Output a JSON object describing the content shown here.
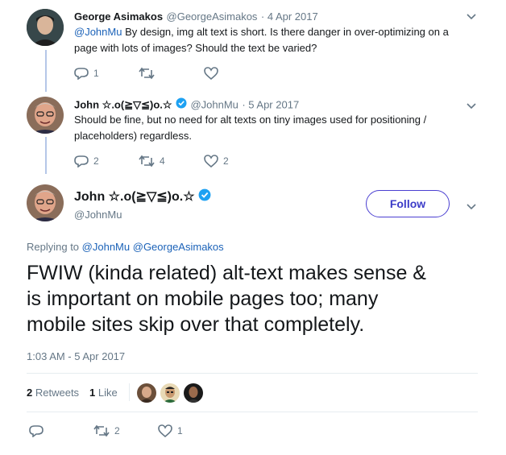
{
  "tweet1": {
    "author_name": "George Asimakos",
    "handle": "@GeorgeAsimakos",
    "date": "· 4 Apr 2017",
    "mention": "@JohnMu",
    "text_after_mention": " By design, img alt text is short. Is there danger in over-optimizing on a",
    "text_line2": "page with lots of images? Should the text be varied?",
    "reply_count": "1",
    "retweet_count": "",
    "like_count": ""
  },
  "tweet2": {
    "author_name": "John ☆.o(≧▽≦)o.☆",
    "handle": "@JohnMu",
    "date": "· 5 Apr 2017",
    "text_line1": "Should be fine, but no need for alt texts on tiny images used for positioning /",
    "text_line2": "placeholders) regardless.",
    "reply_count": "2",
    "retweet_count": "4",
    "like_count": "2"
  },
  "main": {
    "author_name": "John ☆.o(≧▽≦)o.☆",
    "handle": "@JohnMu",
    "follow_label": "Follow",
    "replying_prefix": "Replying to",
    "replying_to_1": "@JohnMu",
    "replying_to_2": "@GeorgeAsimakos",
    "text_line1": "FWIW (kinda related) alt-text makes sense &",
    "text_line2": "is important on mobile pages too; many",
    "text_line3": "mobile sites skip over that completely.",
    "timestamp": "1:03 AM - 5 Apr 2017",
    "retweets_num": "2",
    "retweets_label": "Retweets",
    "likes_num": "1",
    "likes_label": "Like",
    "reply_count": "",
    "retweet_count": "2",
    "like_count": "1"
  },
  "colors": {
    "link": "#1b62b8",
    "verified": "#1da1f2",
    "follow_border": "#4a3fd1",
    "thread_line": "#b5c7e8"
  },
  "icons": [
    "chevron-down-icon",
    "reply-icon",
    "retweet-icon",
    "like-icon",
    "verified-badge-icon"
  ]
}
